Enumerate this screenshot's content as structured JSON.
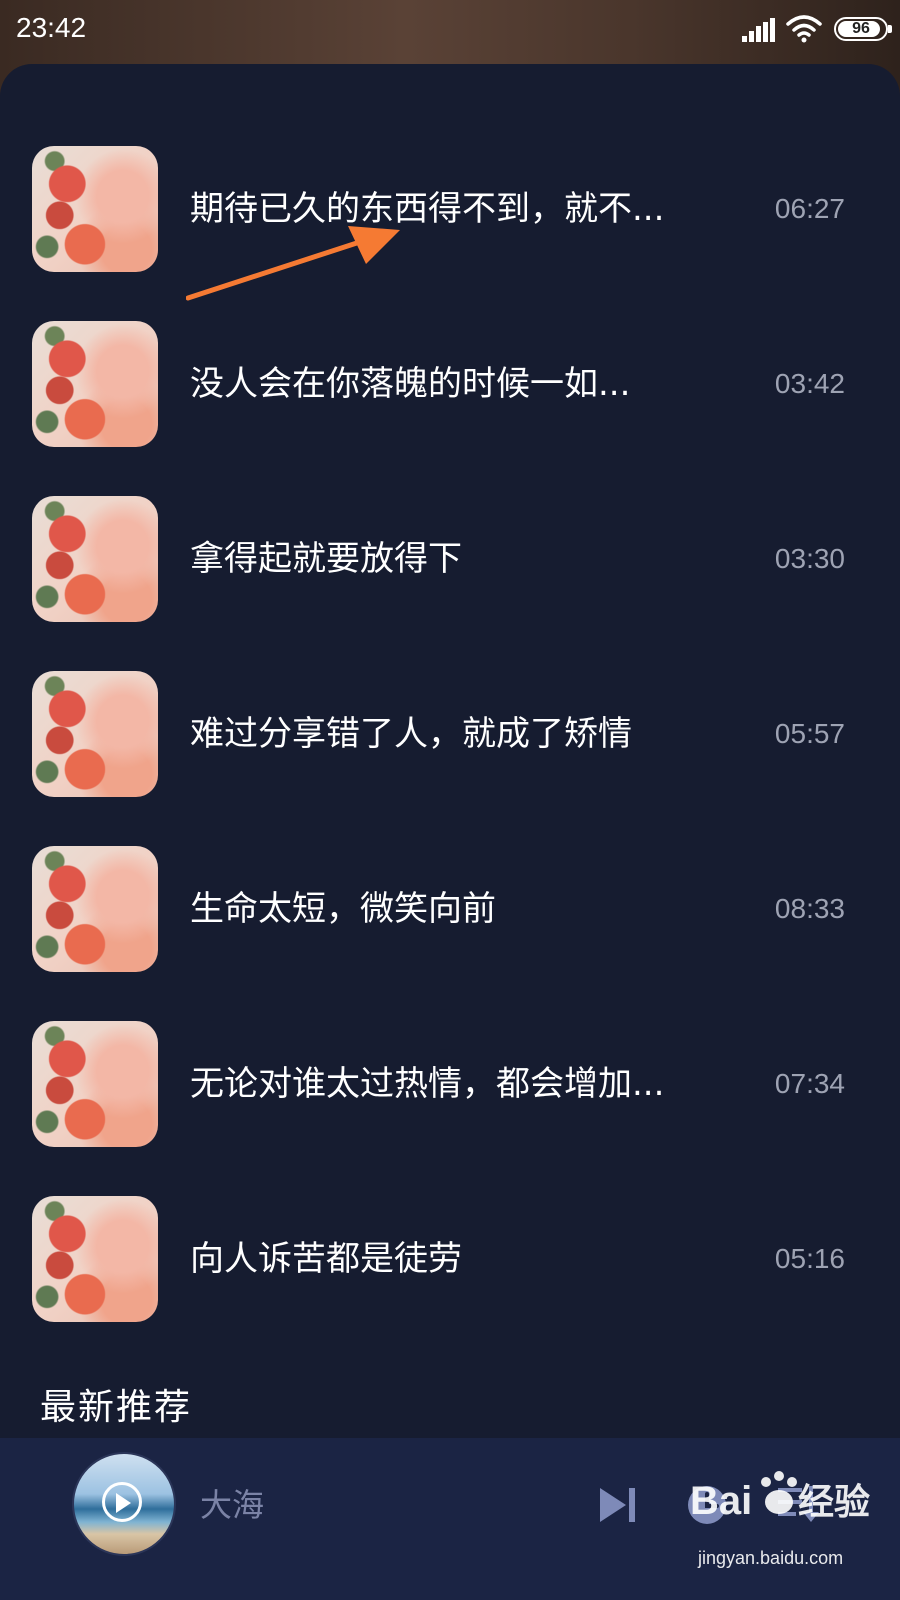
{
  "status_bar": {
    "time": "23:42",
    "battery": "96",
    "icons": [
      "signal-icon",
      "wifi-icon",
      "battery-icon"
    ]
  },
  "songs": [
    {
      "title": "期待已久的东西得不到，就不...",
      "duration": "06:27"
    },
    {
      "title": "没人会在你落魄的时候一如...",
      "duration": "03:42"
    },
    {
      "title": "拿得起就要放得下",
      "duration": "03:30"
    },
    {
      "title": "难过分享错了人，就成了矫情",
      "duration": "05:57"
    },
    {
      "title": "生命太短，微笑向前",
      "duration": "08:33"
    },
    {
      "title": "无论对谁太过热情，都会增加...",
      "duration": "07:34"
    },
    {
      "title": "向人诉苦都是徒劳",
      "duration": "05:16"
    }
  ],
  "section": {
    "title": "最新推荐"
  },
  "player": {
    "title": "大海",
    "icons": [
      "play-icon",
      "next-icon",
      "timer-icon",
      "playlist-icon"
    ]
  },
  "watermark": {
    "text": "jingyan.baidu.com",
    "logo": "Baidu经验"
  },
  "colors": {
    "panel_bg": "#161c30",
    "player_bg": "#1b2444",
    "annotation_arrow": "#f57a33",
    "duration_text": "#9ea3b3",
    "player_text": "#7b83a6"
  }
}
